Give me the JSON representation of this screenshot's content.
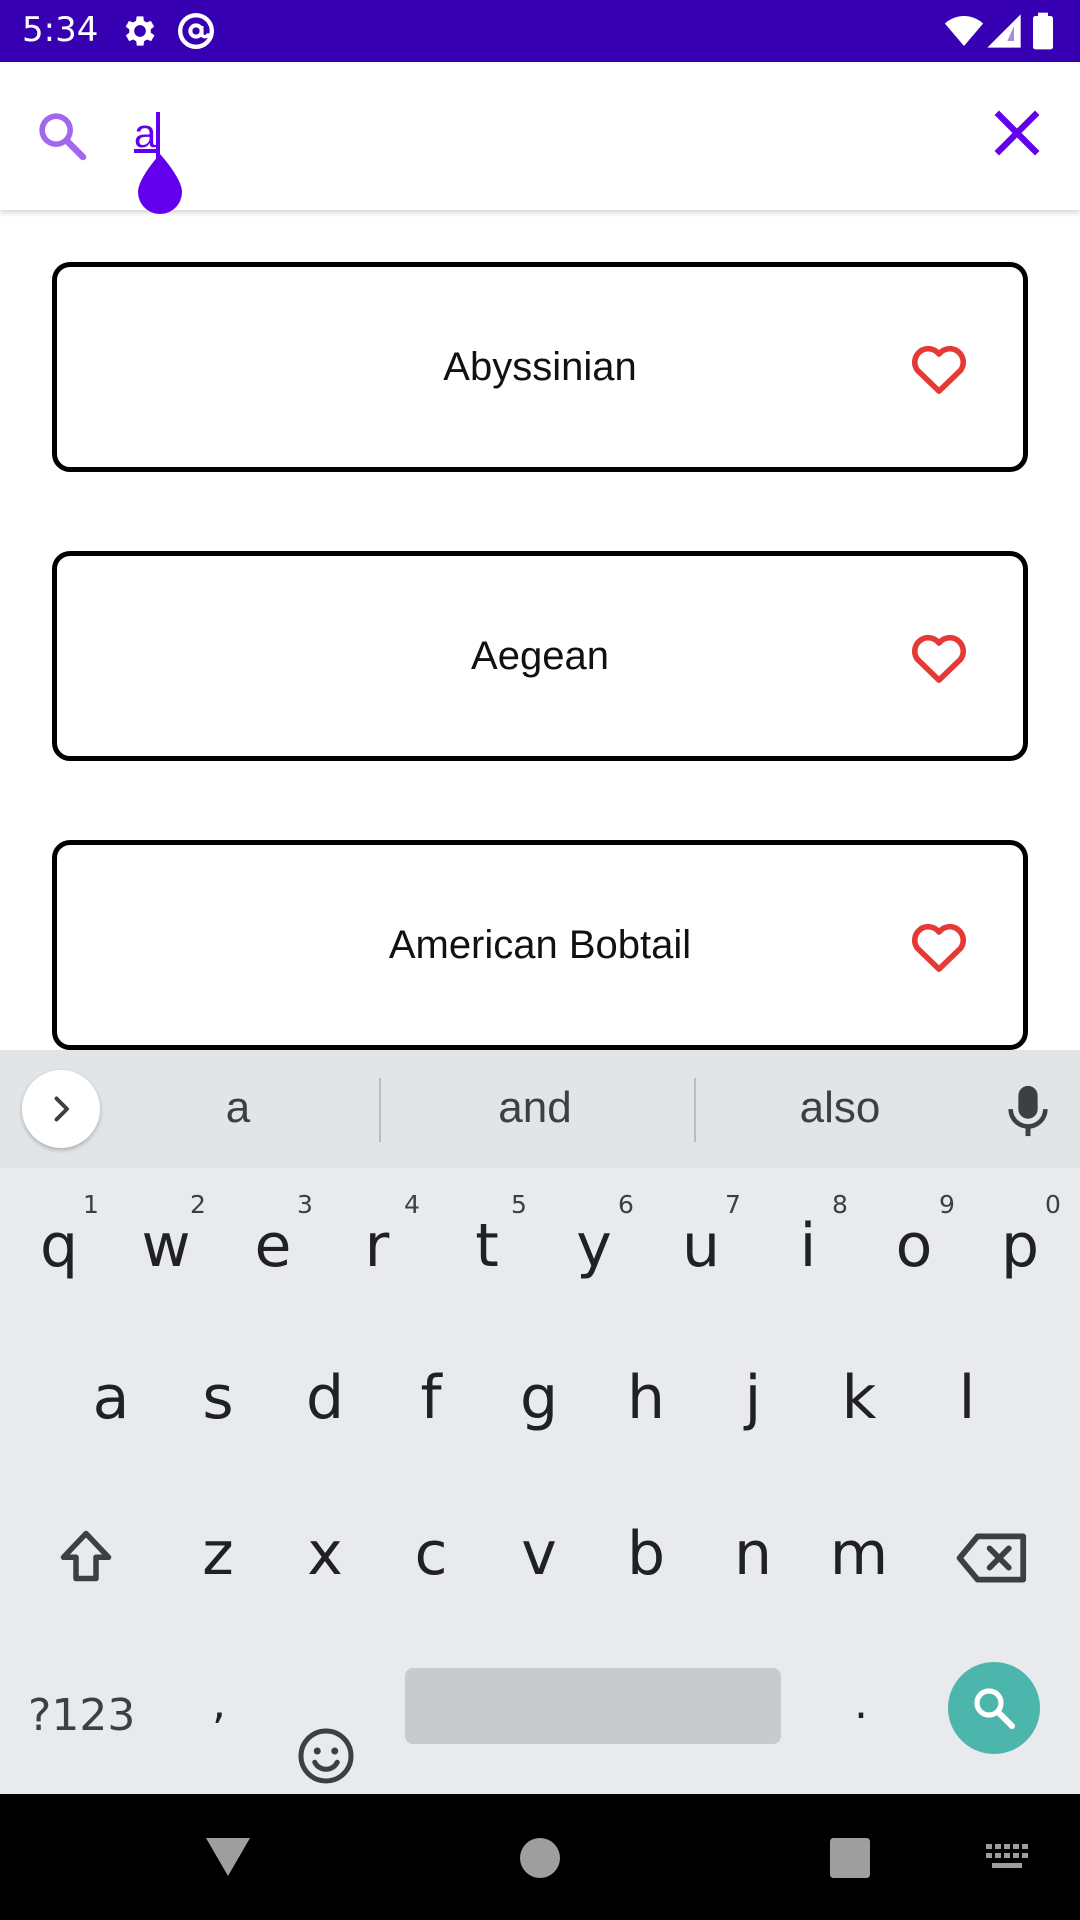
{
  "status_bar": {
    "time": "5:34",
    "background": "#3700b3",
    "left_icons": [
      "settings-icon",
      "at-sign-icon"
    ],
    "right_icons": [
      "wifi-icon",
      "cell-signal-icon",
      "battery-icon"
    ]
  },
  "search": {
    "query": "a",
    "icon": "search-icon",
    "clear_icon": "close-icon",
    "accent_color": "#6200ee"
  },
  "breeds": [
    {
      "name": "Abyssinian",
      "favorite_icon": "heart-outline-icon"
    },
    {
      "name": "Aegean",
      "favorite_icon": "heart-outline-icon"
    },
    {
      "name": "American Bobtail",
      "favorite_icon": "heart-outline-icon"
    }
  ],
  "keyboard": {
    "suggestions": [
      "a",
      "and",
      "also"
    ],
    "row1": [
      "q",
      "w",
      "e",
      "r",
      "t",
      "y",
      "u",
      "i",
      "o",
      "p"
    ],
    "row1_hints": [
      "1",
      "2",
      "3",
      "4",
      "5",
      "6",
      "7",
      "8",
      "9",
      "0"
    ],
    "row2": [
      "a",
      "s",
      "d",
      "f",
      "g",
      "h",
      "j",
      "k",
      "l"
    ],
    "row3": [
      "z",
      "x",
      "c",
      "v",
      "b",
      "n",
      "m"
    ],
    "symbols_label": "?123",
    "comma": ",",
    "period": ".",
    "action_color": "#4db6ac"
  },
  "nav_bar": {
    "icons": [
      "back-icon",
      "home-icon",
      "recents-icon",
      "keyboard-switch-icon"
    ]
  }
}
